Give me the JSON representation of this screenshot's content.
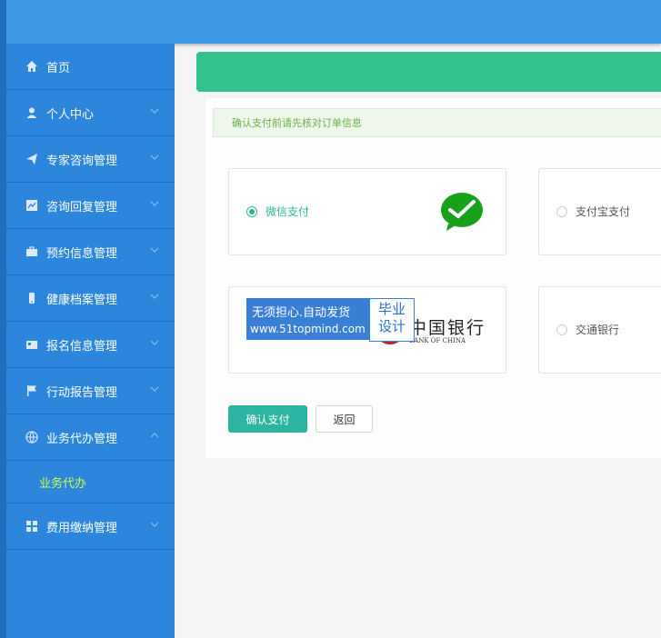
{
  "sidebar": {
    "items": [
      {
        "label": "首页",
        "icon": "home-icon",
        "chevron": ""
      },
      {
        "label": "个人中心",
        "icon": "user-icon",
        "chevron": "down"
      },
      {
        "label": "专家咨询管理",
        "icon": "send-icon",
        "chevron": "down"
      },
      {
        "label": "咨询回复管理",
        "icon": "chart-icon",
        "chevron": "down"
      },
      {
        "label": "预约信息管理",
        "icon": "briefcase-icon",
        "chevron": "down"
      },
      {
        "label": "健康档案管理",
        "icon": "mobile-icon",
        "chevron": "down"
      },
      {
        "label": "报名信息管理",
        "icon": "card-icon",
        "chevron": "down"
      },
      {
        "label": "行动报告管理",
        "icon": "flag-icon",
        "chevron": "down"
      },
      {
        "label": "业务代办管理",
        "icon": "globe-icon",
        "chevron": "up"
      },
      {
        "label": "费用缴纳管理",
        "icon": "grid-icon",
        "chevron": "down"
      }
    ],
    "submenu": {
      "label": "业务代办"
    },
    "active_sub_color": "#c6ff4a"
  },
  "notice": {
    "text": "确认支付前请先核对订单信息"
  },
  "payment": {
    "options": [
      {
        "label": "微信支付",
        "checked": true,
        "logo": "wechat-pay-logo"
      },
      {
        "label": "支付宝支付",
        "checked": false
      },
      {
        "label": "交通银行",
        "checked": false
      }
    ],
    "bank_logo_text": "中国银行",
    "bank_logo_sub": "BANK OF CHINA"
  },
  "watermark": {
    "line1": "无须担心.自动发货",
    "line2": "www.51topmind.com",
    "tag1": "毕业",
    "tag2": "设计"
  },
  "buttons": {
    "confirm": "确认支付",
    "back": "返回"
  },
  "colors": {
    "topbar": "#3f98e8",
    "sidebar": "#2c86dc",
    "banner": "#33c18e",
    "primary": "#2bb5a0"
  }
}
